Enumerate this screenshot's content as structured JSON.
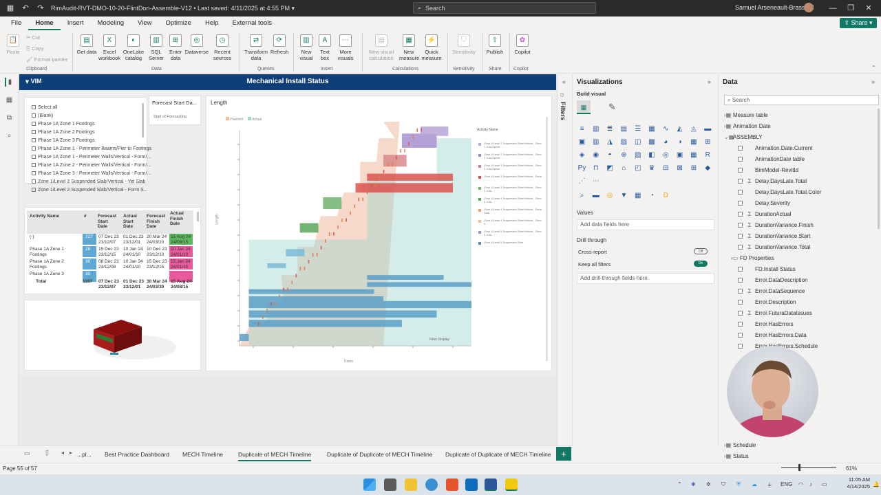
{
  "titlebar": {
    "doc_title": "RimAudit-RVT-DMO-10-20-FlintDon-Assemble-V12 • Last saved: 4/11/2025 at 4:55 PM ▾",
    "search": "Search",
    "user": "Samuel Arseneault-Brassard"
  },
  "menu": [
    "File",
    "Home",
    "Insert",
    "Modeling",
    "View",
    "Optimize",
    "Help",
    "External tools"
  ],
  "share": "Share",
  "ribbon": {
    "clipboard": {
      "paste": "Paste",
      "cut": "Cut",
      "copy": "Copy",
      "format_painter": "Format painter",
      "group": "Clipboard"
    },
    "data": {
      "group": "Data",
      "items": [
        "Get data",
        "Excel workbook",
        "OneLake catalog",
        "SQL Server",
        "Enter data",
        "Dataverse",
        "Recent sources"
      ]
    },
    "queries": {
      "group": "Queries",
      "items": [
        "Transform data",
        "Refresh"
      ]
    },
    "insert": {
      "group": "Insert",
      "items": [
        "New visual",
        "Text box",
        "More visuals"
      ]
    },
    "calculations": {
      "group": "Calculations",
      "items": [
        "New visual calculation",
        "New measure",
        "Quick measure"
      ]
    },
    "sensitivity": {
      "group": "Sensitivity",
      "items": [
        "Sensitivity"
      ]
    },
    "share": {
      "group": "Share",
      "items": [
        "Publish"
      ]
    },
    "copilot": {
      "group": "Copilot",
      "items": [
        "Copilot"
      ]
    }
  },
  "report": {
    "logo": "VIM",
    "title": "Mechanical Install Status",
    "slicer_items": [
      "Select all",
      "(Blank)",
      "Phase 1A Zone 1 Footings",
      "Phase 1A Zone 2 Footings",
      "Phase 1A Zone 3 Footings",
      "Phase 1A Zone 1 - Perimeter Beams/Pier to Footings",
      "Phase 1A Zone 1 - Perimeter Walls/Vertical - Form/...",
      "Phase 1A Zone 2 - Perimeter Walls/Vertical - Form/...",
      "Phase 1A Zone 3 - Perimeter Walls/Vertical - Form/...",
      "Zone 1/Level 2 Suspended Slab/Vertical - Yet Slab",
      "Zone 1/Level 2 Suspended Slab/Vertical - Form S..."
    ],
    "forecast_card": {
      "title": "Forecast Start Da...",
      "value": "Start of Forecasting"
    },
    "chart_title": "Length",
    "filter_display": "Filter Display"
  },
  "table": {
    "headers": [
      "Activity Name",
      "#",
      "Forecast Start Date",
      "Actual Start Date",
      "Forecast Finish Date",
      "Actual Finish Date"
    ],
    "rows": [
      {
        "name": "(-)",
        "count": "227",
        "fs": "07 Dec 23 23/12/07",
        "as": "01 Dec 23 23/12/01",
        "ff": "20 Mar 24 24/03/20",
        "af": "15 Aug 24 24/08/15"
      },
      {
        "name": "Phase 1A Zone 1 Footings",
        "count": "26",
        "fs": "15 Dec 23 23/12/15",
        "as": "10 Jan 24 24/01/10",
        "ff": "10 Dec 23 23/12/10",
        "af": "10 Jan 24 24/01/10"
      },
      {
        "name": "Phase 1A Zone 2 Footings",
        "count": "30",
        "fs": "08 Dec 23 23/12/08",
        "as": "10 Jan 24 24/01/10",
        "ff": "15 Dec 23 23/12/15",
        "af": "15 Jan 24 24/01/15"
      },
      {
        "name": "Phase 1A Zone 3",
        "count": "30",
        "fs": "",
        "as": "",
        "ff": "",
        "af": ""
      }
    ],
    "total": {
      "name": "Total",
      "count": "1187",
      "fs": "07 Dec 23 23/12/07",
      "as": "01 Dec 23 23/12/01",
      "ff": "30 Mar 24 24/03/30",
      "af": "15 Aug 24 24/08/15"
    }
  },
  "legend": {
    "title": "Activity Name",
    "top": [
      "Planned",
      "Actual"
    ],
    "items": [
      {
        "label": "Zone 1/Level 2 Suspended Slab/Vertical - Floor 1 Trim/Spline",
        "color": "#b9a5d8"
      },
      {
        "label": "Zone 1/Level 2 Suspended Slab/Vertical - Floor 2 Trim/Spline",
        "color": "#9a8ac8"
      },
      {
        "label": "Zone 1/Level 3 Suspended Slab/Vertical - Floor 3 Trim/Spline",
        "color": "#c97f9a"
      },
      {
        "label": "Zone 1/Level 3 Suspended Slab/Vertical - Form",
        "color": "#d9534f"
      },
      {
        "label": "Zone 1/Level 3 Suspended Slab/Vertical - Floor 3 Trim",
        "color": "#6fb36f"
      },
      {
        "label": "Zone 1/Level 4 Suspended Slab/Vertical - Floor 4 Trim",
        "color": "#5aa65a"
      },
      {
        "label": "Zone 1/Level 4 Suspended Slab/Vertical - Form Slab",
        "color": "#f0a070"
      },
      {
        "label": "Zone 1/Level 4 Suspended Slab/Vertical - Floor 4",
        "color": "#ebc49b"
      },
      {
        "label": "Zone 1/Level 5 Suspended Slab/Vertical - Floor 5 Trim",
        "color": "#a48fd0"
      },
      {
        "label": "Zone 1/Level 5 Suspended Slab",
        "color": "#5a8fb8"
      }
    ]
  },
  "viz": {
    "title": "Visualizations",
    "build": "Build visual",
    "values": "Values",
    "add_data": "Add data fields here",
    "drill": "Drill through",
    "cross": "Cross-report",
    "cross_state": "Off",
    "keep": "Keep all filters",
    "keep_state": "On",
    "add_drill": "Add drill-through fields here"
  },
  "filters_label": "Filters",
  "data": {
    "title": "Data",
    "search": "Search",
    "tables": [
      "Measure table",
      "Animation Date"
    ],
    "assembly": "ASSEMBLY",
    "fields": [
      {
        "name": "Animation.Date.Current",
        "sigma": false
      },
      {
        "name": "AnimationDate table",
        "sigma": false
      },
      {
        "name": "BimModel-RevitId",
        "sigma": false
      },
      {
        "name": "Delay.DaysLate.Total",
        "sigma": true
      },
      {
        "name": "Delay.DaysLate.Total.Color",
        "sigma": false
      },
      {
        "name": "Delay.Severity",
        "sigma": false
      },
      {
        "name": "DurationActual",
        "sigma": true
      },
      {
        "name": "DurationVariance.Finish",
        "sigma": true
      },
      {
        "name": "DurationVariance.Start",
        "sigma": true
      },
      {
        "name": "DurationVariance.Total",
        "sigma": true
      }
    ],
    "folder": "FD Properties",
    "folder_fields": [
      {
        "name": "FD.Install Status",
        "sigma": false
      },
      {
        "name": "Error.DataDescription",
        "sigma": false
      },
      {
        "name": "Error.DataSequence",
        "sigma": true
      },
      {
        "name": "Error.Description",
        "sigma": false
      },
      {
        "name": "Error.FuturaDataIssues",
        "sigma": true
      },
      {
        "name": "Error.HasErrors",
        "sigma": false
      },
      {
        "name": "Error.HasErrors.Data",
        "sigma": false
      },
      {
        "name": "Error.HasErrors.Schedule",
        "sigma": false
      }
    ],
    "bottom_tables": [
      "Schedule",
      "Status"
    ]
  },
  "pages": [
    "...pl...",
    "Best Practice Dashboard",
    "MECH Timeline",
    "Duplicate of MECH Timeline",
    "Duplicate of Duplicate of MECH Timeline",
    "Duplicate of Duplicate of MECH Timeline"
  ],
  "active_page": 3,
  "status": {
    "page": "Page 55 of 57",
    "zoom": "61%"
  },
  "tray": {
    "lang": "ENG",
    "time": "11:05 AM",
    "date": "4/14/2025"
  },
  "chart_data": {
    "type": "bar",
    "title": "Length",
    "xlabel": "Dates",
    "ylabel": "Length",
    "series": [
      {
        "name": "Planned",
        "color": "#f0b9a0"
      },
      {
        "name": "Actual",
        "color": "#9fd6d0"
      }
    ],
    "bars": [
      {
        "x0": 0.0,
        "x1": 0.04,
        "y": 0.02,
        "h": 0.03,
        "c": "#5a9fc8"
      },
      {
        "x0": 0.04,
        "x1": 0.7,
        "y": 0.08,
        "h": 0.03,
        "c": "#5a9fc8"
      },
      {
        "x0": 0.04,
        "x1": 0.85,
        "y": 0.12,
        "h": 0.03,
        "c": "#5a9fc8"
      },
      {
        "x0": 0.04,
        "x1": 1.0,
        "y": 0.16,
        "h": 0.03,
        "c": "#5a9fc8"
      },
      {
        "x0": 0.04,
        "x1": 0.62,
        "y": 0.19,
        "h": 0.02,
        "c": "#5a9fc8"
      },
      {
        "x0": 0.04,
        "x1": 0.58,
        "y": 0.22,
        "h": 0.02,
        "c": "#5a9fc8"
      },
      {
        "x0": 0.55,
        "x1": 1.0,
        "y": 0.25,
        "h": 0.02,
        "c": "#5a9fc8"
      },
      {
        "x0": 0.55,
        "x1": 0.88,
        "y": 0.28,
        "h": 0.02,
        "c": "#5a9fc8"
      },
      {
        "x0": 0.12,
        "x1": 0.2,
        "y": 0.33,
        "h": 0.02,
        "c": "#7ab8d8"
      },
      {
        "x0": 0.2,
        "x1": 0.28,
        "y": 0.38,
        "h": 0.03,
        "c": "#7ab8d8"
      },
      {
        "x0": 0.26,
        "x1": 0.34,
        "y": 0.48,
        "h": 0.04,
        "c": "#5aa65a"
      },
      {
        "x0": 0.36,
        "x1": 0.44,
        "y": 0.58,
        "h": 0.05,
        "c": "#6fb36f"
      },
      {
        "x0": 0.5,
        "x1": 0.92,
        "y": 0.65,
        "h": 0.04,
        "c": "#d9534f"
      },
      {
        "x0": 0.55,
        "x1": 0.92,
        "y": 0.7,
        "h": 0.03,
        "c": "#d9534f"
      },
      {
        "x0": 0.62,
        "x1": 0.72,
        "y": 0.76,
        "h": 0.05,
        "c": "#d98a8a"
      },
      {
        "x0": 0.7,
        "x1": 0.85,
        "y": 0.84,
        "h": 0.06,
        "c": "#a48fd0"
      },
      {
        "x0": 0.78,
        "x1": 0.9,
        "y": 0.89,
        "h": 0.04,
        "c": "#b9a5d8"
      }
    ]
  }
}
